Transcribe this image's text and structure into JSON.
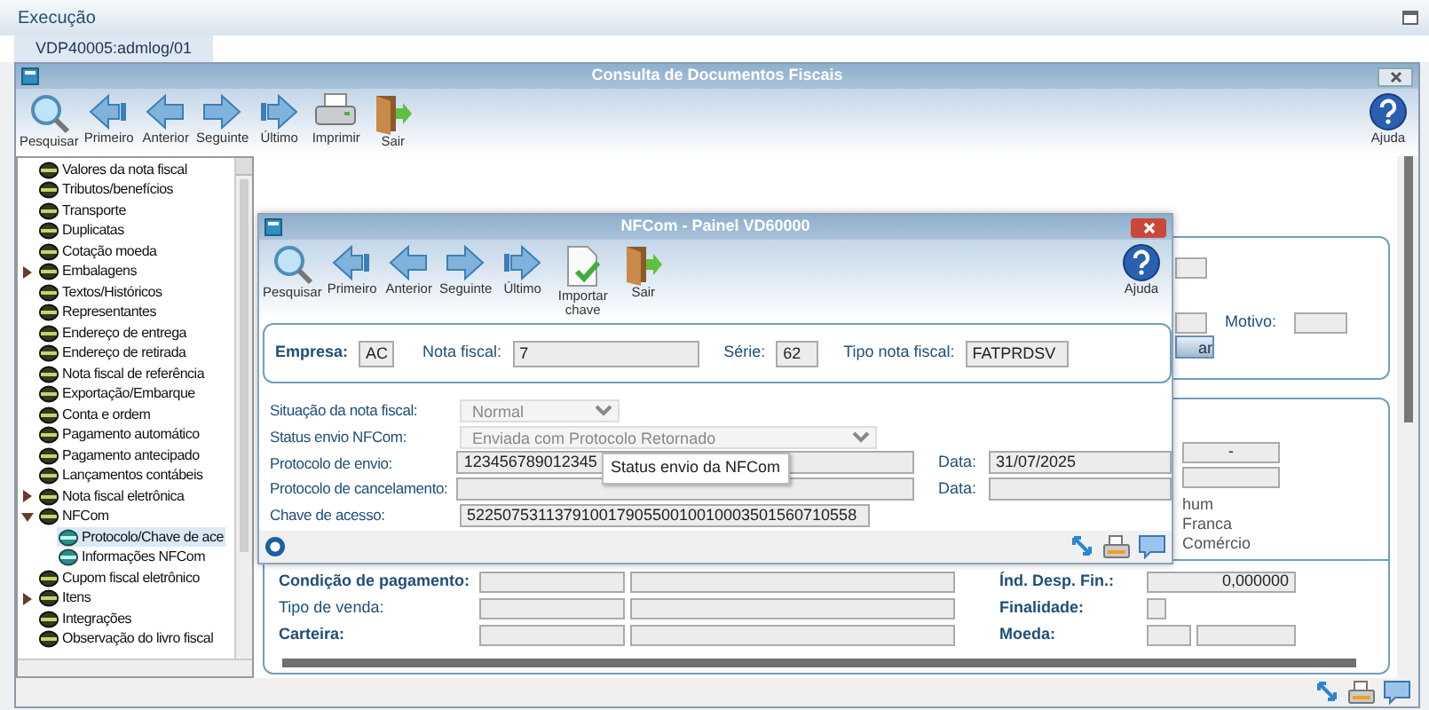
{
  "app": {
    "title": "Execução",
    "tab": "VDP40005:admlog/01"
  },
  "main_window": {
    "title": "Consulta de Documentos Fiscais",
    "toolbar": [
      {
        "kind": "search",
        "label": "Pesquisar"
      },
      {
        "kind": "first",
        "label": "Primeiro"
      },
      {
        "kind": "previous",
        "label": "Anterior"
      },
      {
        "kind": "next",
        "label": "Seguinte"
      },
      {
        "kind": "last",
        "label": "Último"
      },
      {
        "kind": "print",
        "label": "Imprimir"
      },
      {
        "kind": "exit",
        "label": "Sair"
      }
    ],
    "help": "Ajuda",
    "tree": [
      {
        "label": "Valores da nota fiscal",
        "selected": false
      },
      {
        "label": "Tributos/benefícios",
        "selected": false
      },
      {
        "label": "Transporte",
        "selected": false
      },
      {
        "label": "Duplicatas",
        "selected": false
      },
      {
        "label": "Cotação moeda",
        "selected": false
      },
      {
        "label": "Embalagens",
        "selected": false,
        "expanded": false
      },
      {
        "label": "Textos/Históricos",
        "selected": false
      },
      {
        "label": "Representantes",
        "selected": false
      },
      {
        "label": "Endereço de entrega",
        "selected": false
      },
      {
        "label": "Endereço de retirada",
        "selected": false
      },
      {
        "label": "Nota fiscal de referência",
        "selected": false
      },
      {
        "label": "Exportação/Embarque",
        "selected": false
      },
      {
        "label": "Conta e ordem",
        "selected": false
      },
      {
        "label": "Pagamento automático",
        "selected": false
      },
      {
        "label": "Pagamento antecipado",
        "selected": false
      },
      {
        "label": "Lançamentos contábeis",
        "selected": false
      },
      {
        "label": "Nota fiscal eletrônica",
        "selected": false,
        "expanded": false
      },
      {
        "label": "NFCom",
        "selected": false,
        "expanded": true,
        "children": [
          {
            "label": "Protocolo/Chave de ace",
            "selected": true
          },
          {
            "label": "Informações NFCom",
            "selected": false
          }
        ]
      },
      {
        "label": "Cupom fiscal eletrônico",
        "selected": false
      },
      {
        "label": "Itens",
        "selected": false,
        "expanded": false
      },
      {
        "label": "Integrações",
        "selected": false
      },
      {
        "label": "Observação do livro fiscal",
        "selected": false
      }
    ],
    "filter_group": {
      "motivo_label": "Motivo:",
      "button": "ar"
    },
    "options_group": {
      "field_value": "-",
      "options": [
        "hum",
        "Franca",
        "Comércio"
      ]
    },
    "payment_form": {
      "rows": [
        {
          "label": "Condição de pagamento:",
          "bold": true,
          "right_label": "Índ. Desp. Fin.:",
          "kind": "number",
          "right_value": "0,000000"
        },
        {
          "label": "Tipo de venda:",
          "bold": false,
          "right_label": "Finalidade:",
          "kind": "small"
        },
        {
          "label": "Carteira:",
          "bold": true,
          "right_label": "Moeda:",
          "kind": "pair"
        }
      ]
    }
  },
  "dialog": {
    "title": "NFCom - Painel VD60000",
    "toolbar": [
      {
        "kind": "search",
        "label": "Pesquisar"
      },
      {
        "kind": "first",
        "label": "Primeiro"
      },
      {
        "kind": "previous",
        "label": "Anterior"
      },
      {
        "kind": "next",
        "label": "Seguinte"
      },
      {
        "kind": "last",
        "label": "Último"
      },
      {
        "kind": "import",
        "label": "Importar chave"
      },
      {
        "kind": "exit",
        "label": "Sair"
      }
    ],
    "help": "Ajuda",
    "header": [
      {
        "label": "Empresa:",
        "value": "AC",
        "bold": true
      },
      {
        "label": "Nota fiscal:",
        "value": "7",
        "bold": false
      },
      {
        "label": "Série:",
        "value": "62",
        "bold": false
      },
      {
        "label": "Tipo nota fiscal:",
        "value": "FATPRDSV",
        "bold": false
      }
    ],
    "fields": [
      {
        "kind": "select",
        "label": "Situação da nota fiscal:",
        "value": "Normal",
        "disabled": true
      },
      {
        "kind": "select",
        "label": "Status envio NFCom:",
        "value": "Enviada com Protocolo Retornado",
        "disabled": true
      },
      {
        "kind": "text_date",
        "label": "Protocolo de envio:",
        "value": "123456789012345",
        "date_label": "Data:",
        "date": "31/07/2025"
      },
      {
        "kind": "text_date",
        "label": "Protocolo de cancelamento:",
        "date_label": "Data:"
      },
      {
        "kind": "text",
        "label": "Chave de acesso:",
        "value": "52250753113791001790550010010003501560710558"
      }
    ],
    "tooltip": "Status envio da NFCom"
  }
}
